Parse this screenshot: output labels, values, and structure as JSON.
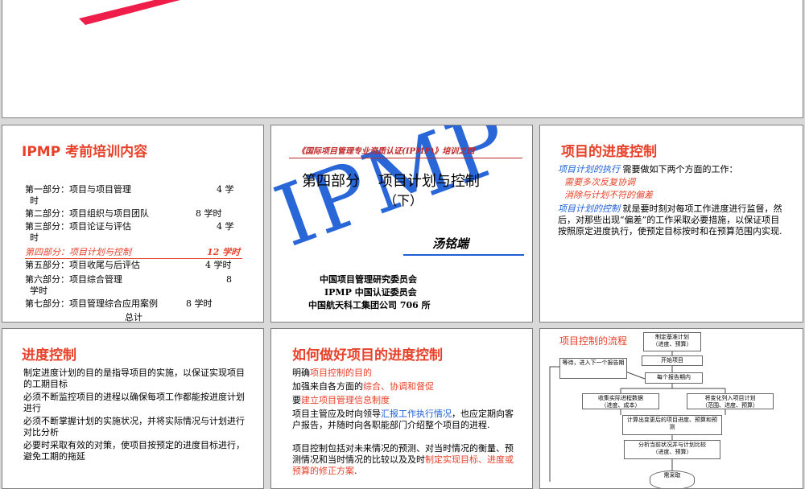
{
  "slide3": {
    "title": "IPMP 考前培训内容",
    "parts": [
      {
        "label": "第一部分：项目与项目管理",
        "hours": "4 学",
        "wrap": "时"
      },
      {
        "label": "第二部分：项目组织与项目团队",
        "hours": "8 学时"
      },
      {
        "label": "第三部分：项目论证与评估",
        "hours": "4 学",
        "wrap": "时"
      },
      {
        "label": "第四部分：项目计划与控制",
        "hours": "12 学时"
      },
      {
        "label": "第五部分：项目收尾与后评估",
        "hours": "4 学时"
      },
      {
        "label": "第六部分：项目综合管理",
        "hours": "8",
        "wrap": "学时"
      },
      {
        "label": "第七部分：项目管理综合应用案例",
        "hours": "8 学时"
      }
    ],
    "total": "总计"
  },
  "slide4": {
    "header": "《国际项目管理专业资质认证(IPMP)》培训之四",
    "title": "第四部分    项目计划与控制",
    "subtitle": "（下）",
    "watermark": "IPMP",
    "author": "汤铭端",
    "org1": "中国项目管理研究委员会",
    "org2": "IPMP 中国认证委员会",
    "org3": "中国航天科工集团公司 706 所"
  },
  "slide5": {
    "title": "项目的进度控制",
    "p1_lead": "项目计划的执行",
    "p1_rest": " 需要做如下两个方面的工作：",
    "bullet1": "需要多次反复协调",
    "bullet2": "消除与计划不符的偏差",
    "p2_lead": "项目计划的控制",
    "p2_rest": " 就是要时刻对每项工作进度进行监督，然后，对那些出现“偏差”的工作采取必要措施，以保证项目按照原定进度执行，使预定目标按时和在预算范围内实现."
  },
  "slide6": {
    "title": "进度控制",
    "items": [
      "制定进度计划的目的是指导项目的实施，以保证实现项目的工期目标",
      "必须不断监控项目的进程以确保每项工作都能按进度计划进行",
      "必须不断掌握计划的实施状况，并将实际情况与计划进行对比分析",
      "必要时采取有效的对策，使项目按预定的进度目标进行，避免工期的拖延"
    ]
  },
  "slide7": {
    "title": "如何做好项目的进度控制",
    "l1a": "明确",
    "l1b": "项目控制的目的",
    "l2a": "加强来自各方面的",
    "l2b": "综合、协调和督促",
    "l3a": "要",
    "l3b": "建立项目管理信息制度",
    "l4a": "项目主管应及时向领导",
    "l4b": "汇报工作执行情况",
    "l4c": "，也应定期向客户报告，并随时向各职能部门介绍整个项目的进程.",
    "l5a": "项目控制包括对未来情况的预测、对当时情况的衡量、预测情况和当时情况的比较以及及时",
    "l5b": "制定实现目标、进度或预算的修正方案",
    "l5c": "."
  },
  "slide8": {
    "title": "项目控制的流程",
    "boxes": {
      "b1": "制定基准计划\n（进度、预算）",
      "b2": "开始项目",
      "b3": "等待，进入下一个报告期",
      "b4": "每个报告期内",
      "b5": "收集实际进程数据\n（进度、成本）",
      "b6": "将变化列入项目计划\n（范围、进度、预算）",
      "b7": "计算出变更后的项目进度、预算和预测",
      "b8": "分析当前状况并与计划比较\n（进度、预算）",
      "b9": "需采取"
    }
  }
}
